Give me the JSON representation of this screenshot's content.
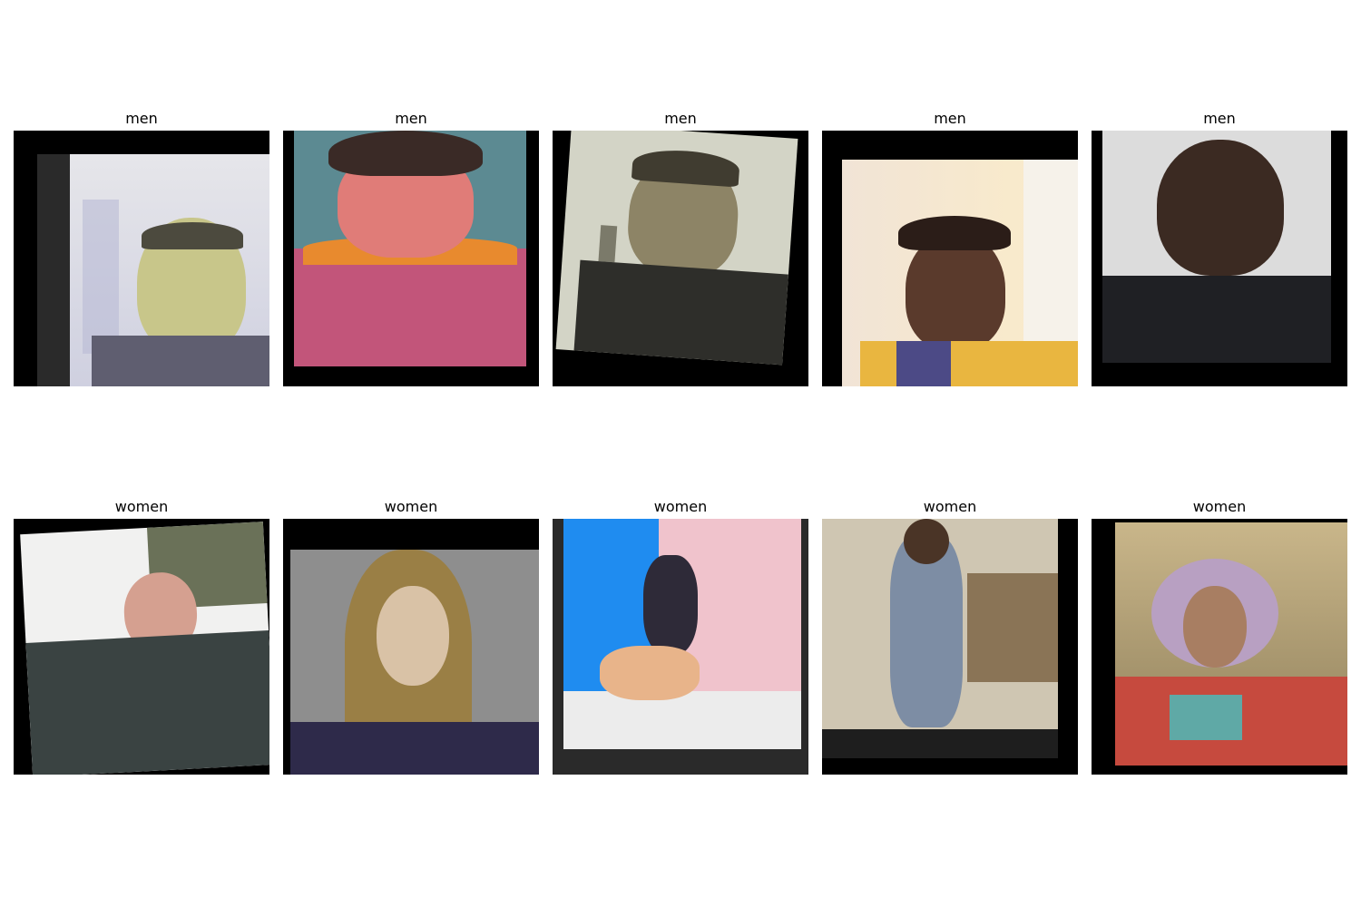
{
  "grid": {
    "row1": [
      {
        "title": "men"
      },
      {
        "title": "men"
      },
      {
        "title": "men"
      },
      {
        "title": "men"
      },
      {
        "title": "men"
      }
    ],
    "row2": [
      {
        "title": "women"
      },
      {
        "title": "women"
      },
      {
        "title": "women"
      },
      {
        "title": "women"
      },
      {
        "title": "women"
      }
    ]
  }
}
